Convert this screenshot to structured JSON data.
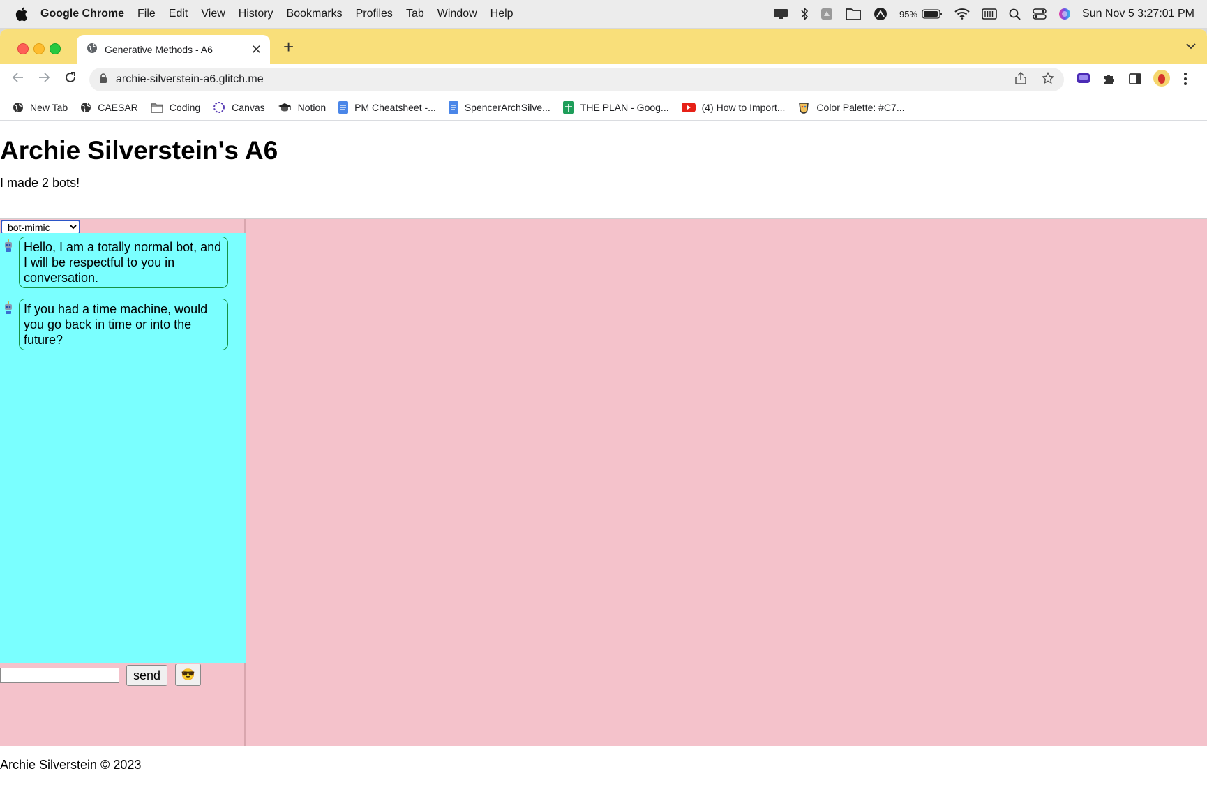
{
  "menubar": {
    "app_name": "Google Chrome",
    "items": [
      "File",
      "Edit",
      "View",
      "History",
      "Bookmarks",
      "Profiles",
      "Tab",
      "Window",
      "Help"
    ],
    "battery_percent": "95%",
    "clock": "Sun Nov 5  3:27:01 PM"
  },
  "browser": {
    "tab_title": "Generative Methods - A6",
    "url": "archie-silverstein-a6.glitch.me",
    "tabstrip_color": "#f9df7a",
    "bookmarks": [
      {
        "label": "New Tab",
        "icon": "globe-icon"
      },
      {
        "label": "CAESAR",
        "icon": "globe-icon"
      },
      {
        "label": "Coding",
        "icon": "folder-icon"
      },
      {
        "label": "Canvas",
        "icon": "canvas-icon"
      },
      {
        "label": "Notion",
        "icon": "graduation-cap-icon"
      },
      {
        "label": "PM Cheatsheet -...",
        "icon": "google-docs-icon"
      },
      {
        "label": "SpencerArchSilve...",
        "icon": "google-docs-icon"
      },
      {
        "label": "THE PLAN - Goog...",
        "icon": "google-sheets-icon"
      },
      {
        "label": "(4) How to Import...",
        "icon": "youtube-icon"
      },
      {
        "label": "Color Palette: #C7...",
        "icon": "palette-icon"
      }
    ]
  },
  "page": {
    "title": "Archie Silverstein's A6",
    "subtitle": "I made 2 bots!",
    "background_color": "#f4c2cb",
    "chat_color": "#7affff",
    "bot_select": {
      "selected": "bot-mimic"
    },
    "messages": [
      {
        "text": "Hello, I am a totally normal bot, and I will be respectful to you in conversation.",
        "avatar": "robot-emoji-icon"
      },
      {
        "text": "If you had a time machine, would you go back in time or into the future?",
        "avatar": "robot-emoji-icon"
      }
    ],
    "input": {
      "value": "",
      "placeholder": ""
    },
    "send_label": "send",
    "emoji_button": "😎",
    "footer": "Archie Silverstein © 2023"
  }
}
